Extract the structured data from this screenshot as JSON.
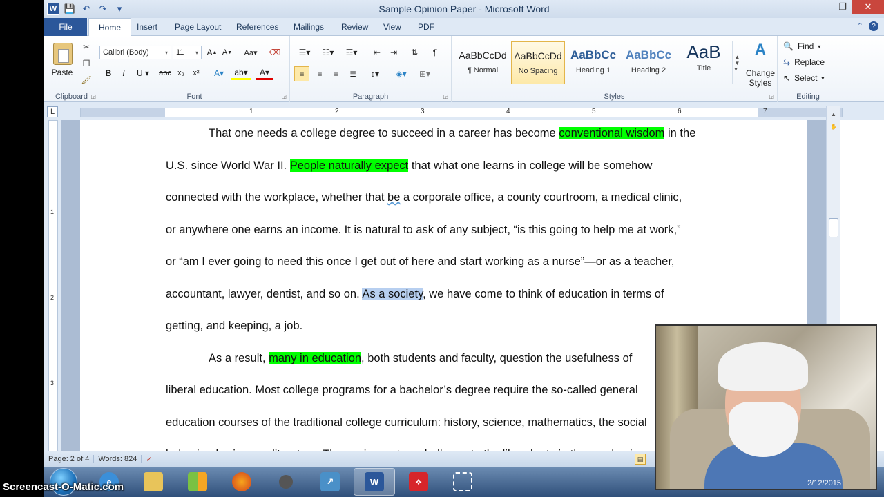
{
  "window": {
    "title": "Sample Opinion Paper  -  Microsoft Word",
    "app_logo": "W",
    "minimize": "–",
    "maximize": "❐",
    "close": "✕"
  },
  "tabs": {
    "file": "File",
    "items": [
      "Home",
      "Insert",
      "Page Layout",
      "References",
      "Mailings",
      "Review",
      "View",
      "PDF"
    ]
  },
  "ribbon": {
    "clipboard": {
      "label": "Clipboard",
      "paste": "Paste"
    },
    "font": {
      "label": "Font",
      "family": "Calibri (Body)",
      "size": "11"
    },
    "paragraph": {
      "label": "Paragraph"
    },
    "styles": {
      "label": "Styles",
      "items": [
        {
          "sample": "AaBbCcDd",
          "name": "¶ Normal"
        },
        {
          "sample": "AaBbCcDd",
          "name": "No Spacing"
        },
        {
          "sample": "AaBbCc",
          "name": "Heading 1"
        },
        {
          "sample": "AaBbCc",
          "name": "Heading 2"
        },
        {
          "sample": "AaB",
          "name": "Title"
        }
      ],
      "change_styles": "Change Styles"
    },
    "editing": {
      "label": "Editing",
      "find": "Find",
      "replace": "Replace",
      "select": "Select"
    }
  },
  "ruler": {
    "tab_selector": "L",
    "numbers": [
      "1",
      "2",
      "3",
      "4",
      "5",
      "6",
      "7"
    ],
    "v_numbers": [
      "1",
      "2",
      "3"
    ]
  },
  "document": {
    "p1": [
      {
        "text": "That one needs a college degree to succeed in a career has become ",
        "hl": ""
      },
      {
        "text": "conventional wisdom",
        "hl": "green"
      },
      {
        "text": " in the",
        "hl": ""
      }
    ],
    "lines": [
      "U.S. since World War II.  ",
      "People naturally expect",
      " that what one learns in college will be somehow",
      "connected with the workplace, whether that ",
      "be",
      " a corporate office, a county courtroom, a medical clinic,",
      "or anywhere one earns an income.  It is natural to ask of any subject, “is this going to help me at work,”",
      "or “am I ever going to need this once I get out of here and start working as a nurse”—or as a teacher,",
      "accountant, lawyer, dentist, and so on.  ",
      "As a society",
      ", we have come to think of education in terms of",
      "getting, and keeping, a job.",
      "As a result, ",
      "many in education",
      ", both students and faculty, question the usefulness of",
      "liberal education.  Most college programs for a bachelor’s degree require the so-called general",
      "education courses of the traditional college curriculum: history, science, mathematics, the social",
      "behavioral sciences, literature.  These give us to a challenge to the liberal arts in the academic"
    ]
  },
  "status": {
    "page": "Page: 2 of 4",
    "words": "Words: 824"
  },
  "taskbar": {
    "watermark": "Screencast-O-Matic.com"
  },
  "webcam": {
    "date": "2/12/2015"
  },
  "colors": {
    "accent": "#2b579a",
    "highlight": "#00ff00",
    "selection": "#b7cff0"
  }
}
